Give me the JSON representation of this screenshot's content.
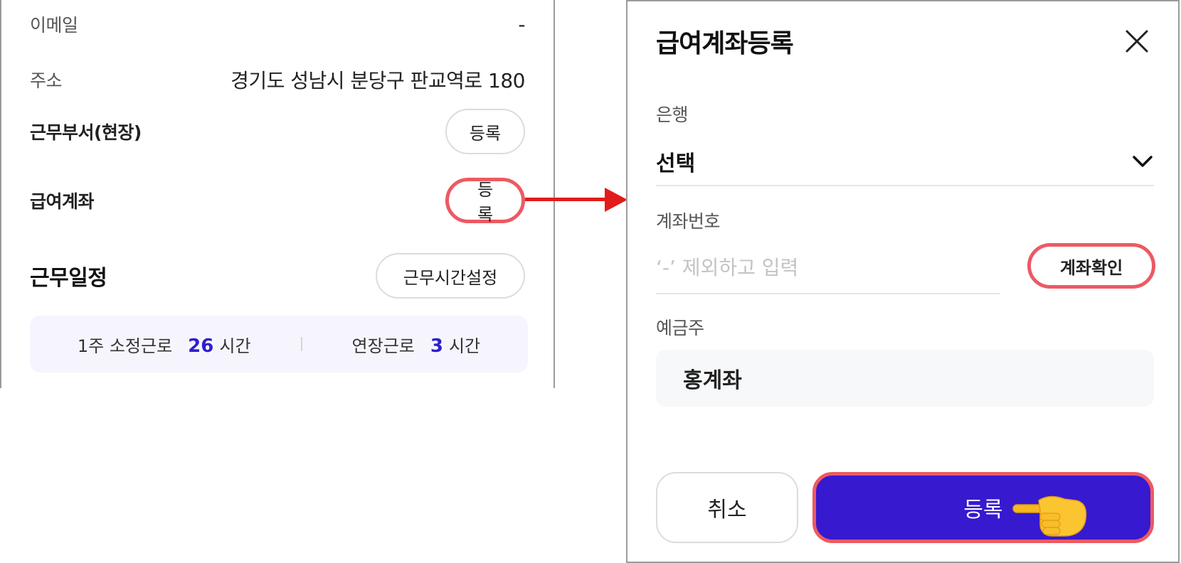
{
  "left_panel": {
    "email": {
      "label": "이메일",
      "value": "-"
    },
    "address": {
      "label": "주소",
      "value": "경기도 성남시 분당구 판교역로 180"
    },
    "department": {
      "label": "근무부서(현장)",
      "button": "등록"
    },
    "salary_account": {
      "label": "급여계좌",
      "button": "등록"
    },
    "schedule": {
      "title": "근무일정",
      "button": "근무시간설정",
      "summary": {
        "regular_label": "1주 소정근로",
        "regular_hours": "26",
        "overtime_label": "연장근로",
        "overtime_hours": "3",
        "unit": "시간"
      }
    }
  },
  "modal": {
    "title": "급여계좌등록",
    "bank": {
      "label": "은행",
      "value": "선택"
    },
    "account_number": {
      "label": "계좌번호",
      "placeholder": "‘-’ 제외하고 입력",
      "verify_button": "계좌확인"
    },
    "account_holder": {
      "label": "예금주",
      "value": "홍계좌"
    },
    "cancel_button": "취소",
    "submit_button": "등록"
  },
  "colors": {
    "accent": "#3719cf",
    "highlight": "#ec5a63",
    "arrow": "#e21b1b",
    "number": "#2f1fc9"
  },
  "icons": [
    "close-icon",
    "chevron-down-icon",
    "pointing-hand-icon",
    "arrow-right-icon"
  ]
}
